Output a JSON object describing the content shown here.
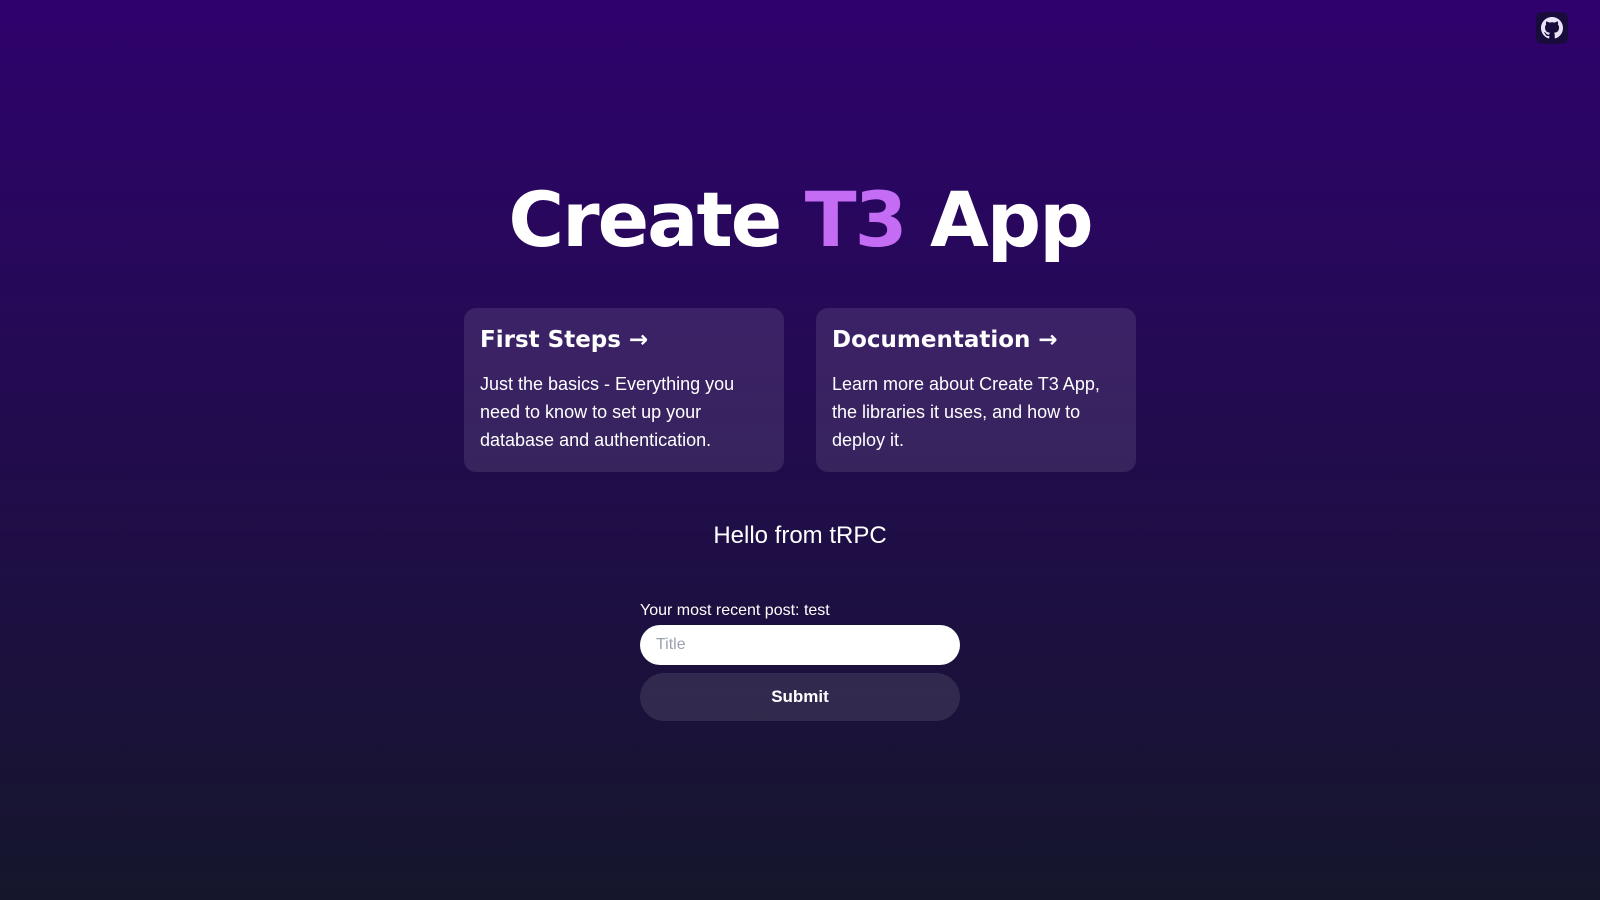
{
  "header": {
    "github_icon": "github-icon"
  },
  "hero": {
    "title_part1": "Create ",
    "title_accent": "T3",
    "title_part2": " App",
    "accent_color": "#c46cf4"
  },
  "cards": [
    {
      "title": "First Steps →",
      "body": "Just the basics - Everything you need to know to set up your database and authentication."
    },
    {
      "title": "Documentation →",
      "body": "Learn more about Create T3 App, the libraries it uses, and how to deploy it."
    }
  ],
  "greeting": "Hello from tRPC",
  "post": {
    "recent_label": "Your most recent post: test",
    "input_placeholder": "Title",
    "input_value": "",
    "submit_label": "Submit"
  },
  "colors": {
    "background_top": "#2e026d",
    "background_bottom": "#15162c"
  }
}
